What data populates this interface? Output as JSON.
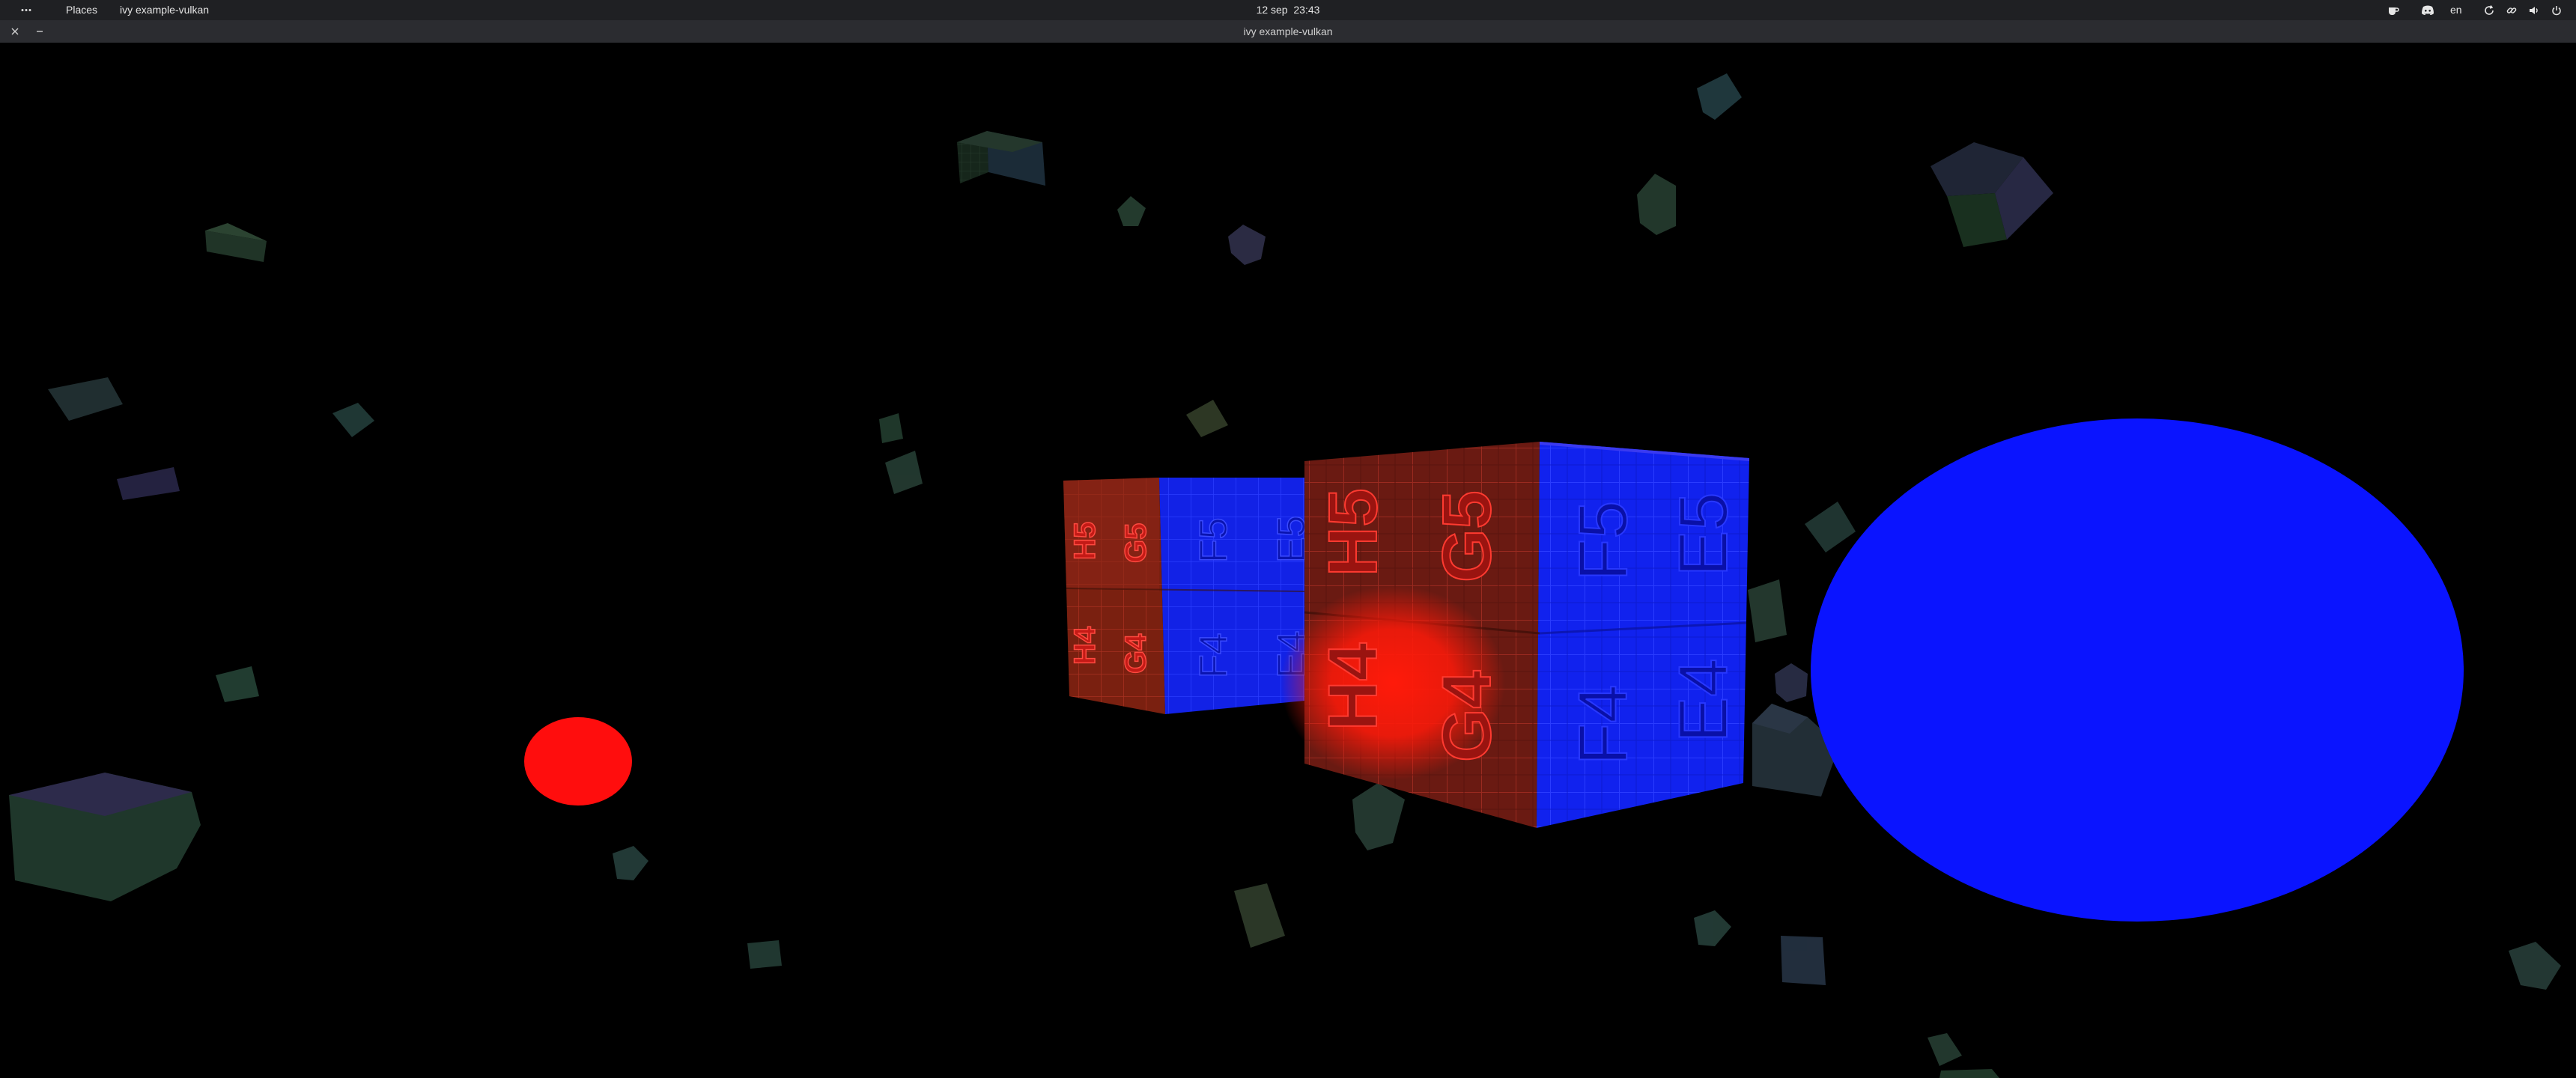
{
  "top_panel": {
    "menu_icon": "dots-menu-icon",
    "places_label": "Places",
    "active_app_label": "ivy example-vulkan",
    "date": "12 sep",
    "time": "23:43",
    "language": "en",
    "status_icons": [
      "tea-icon",
      "discord-icon",
      "update-icon",
      "link-icon",
      "volume-icon",
      "power-icon"
    ]
  },
  "window": {
    "title": "ivy example-vulkan",
    "close_icon": "close-icon",
    "minimize_icon": "minimize-icon"
  },
  "scene": {
    "background_color": "#000000",
    "big_cube_front": {
      "left_face_labels": [
        "H5",
        "G5",
        "H4",
        "G4"
      ],
      "right_face_labels": [
        "F5",
        "E5",
        "F4",
        "E4"
      ]
    },
    "big_cube_back": {
      "left_face_labels": [
        "H5",
        "G5",
        "H4",
        "G4"
      ],
      "right_face_labels": [
        "F5",
        "E5",
        "F4",
        "E4"
      ]
    },
    "colors": {
      "red_light": "#ff1010",
      "blue_light": "#0a14ff",
      "red_face": "#c21a12",
      "blue_face": "#1326f2"
    }
  }
}
